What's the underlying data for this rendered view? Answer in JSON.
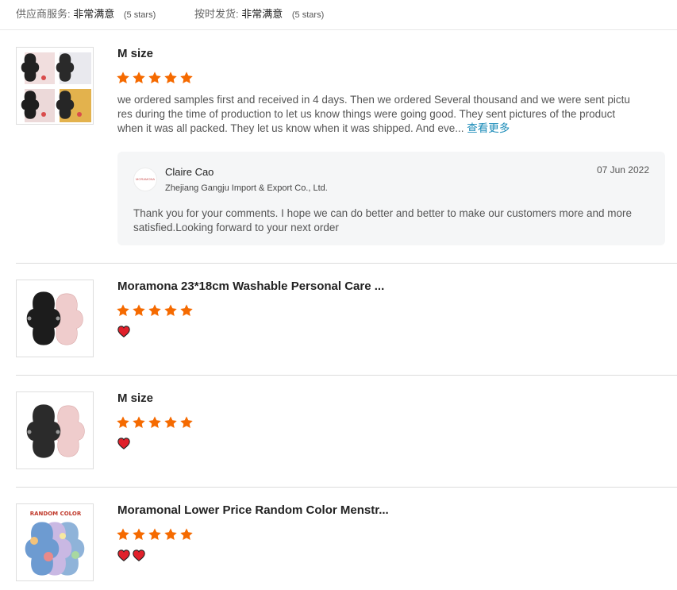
{
  "supplier_ratings": [
    {
      "label": "供应商服务:",
      "value": "非常满意",
      "stars_text": "(5 stars)"
    },
    {
      "label": "按时发货:",
      "value": "非常满意",
      "stars_text": "(5 stars)"
    }
  ],
  "reviews": [
    {
      "title": "M size",
      "rating": 5,
      "text": "we ordered samples first and received in 4 days. Then we ordered Several thousand and we were sent pictu res during the time of production to let us know things were going good. They sent pictures of the product when it was all packed. They let us know when it was shipped. And eve...",
      "more_label": "查看更多",
      "reply": {
        "avatar_text": "MORAMONA",
        "name": "Claire Cao",
        "company": "Zhejiang Gangju Import & Export Co., Ltd.",
        "date": "07 Jun 2022",
        "text": "Thank you for your comments. I hope we can do better and better to make our customers more and more satisfied.Looking forward to your next order"
      }
    },
    {
      "title": "Moramona 23*18cm Washable Personal Care ...",
      "rating": 5,
      "hearts": 1
    },
    {
      "title": "M size",
      "rating": 5,
      "hearts": 1
    },
    {
      "title": "Moramonal Lower Price Random Color Menstr...",
      "rating": 5,
      "hearts": 2,
      "thumb_label": "RANDOM COLOR"
    }
  ],
  "colors": {
    "star": "#f56a00",
    "heart": "#e0202a",
    "link": "#1a8bb8"
  }
}
